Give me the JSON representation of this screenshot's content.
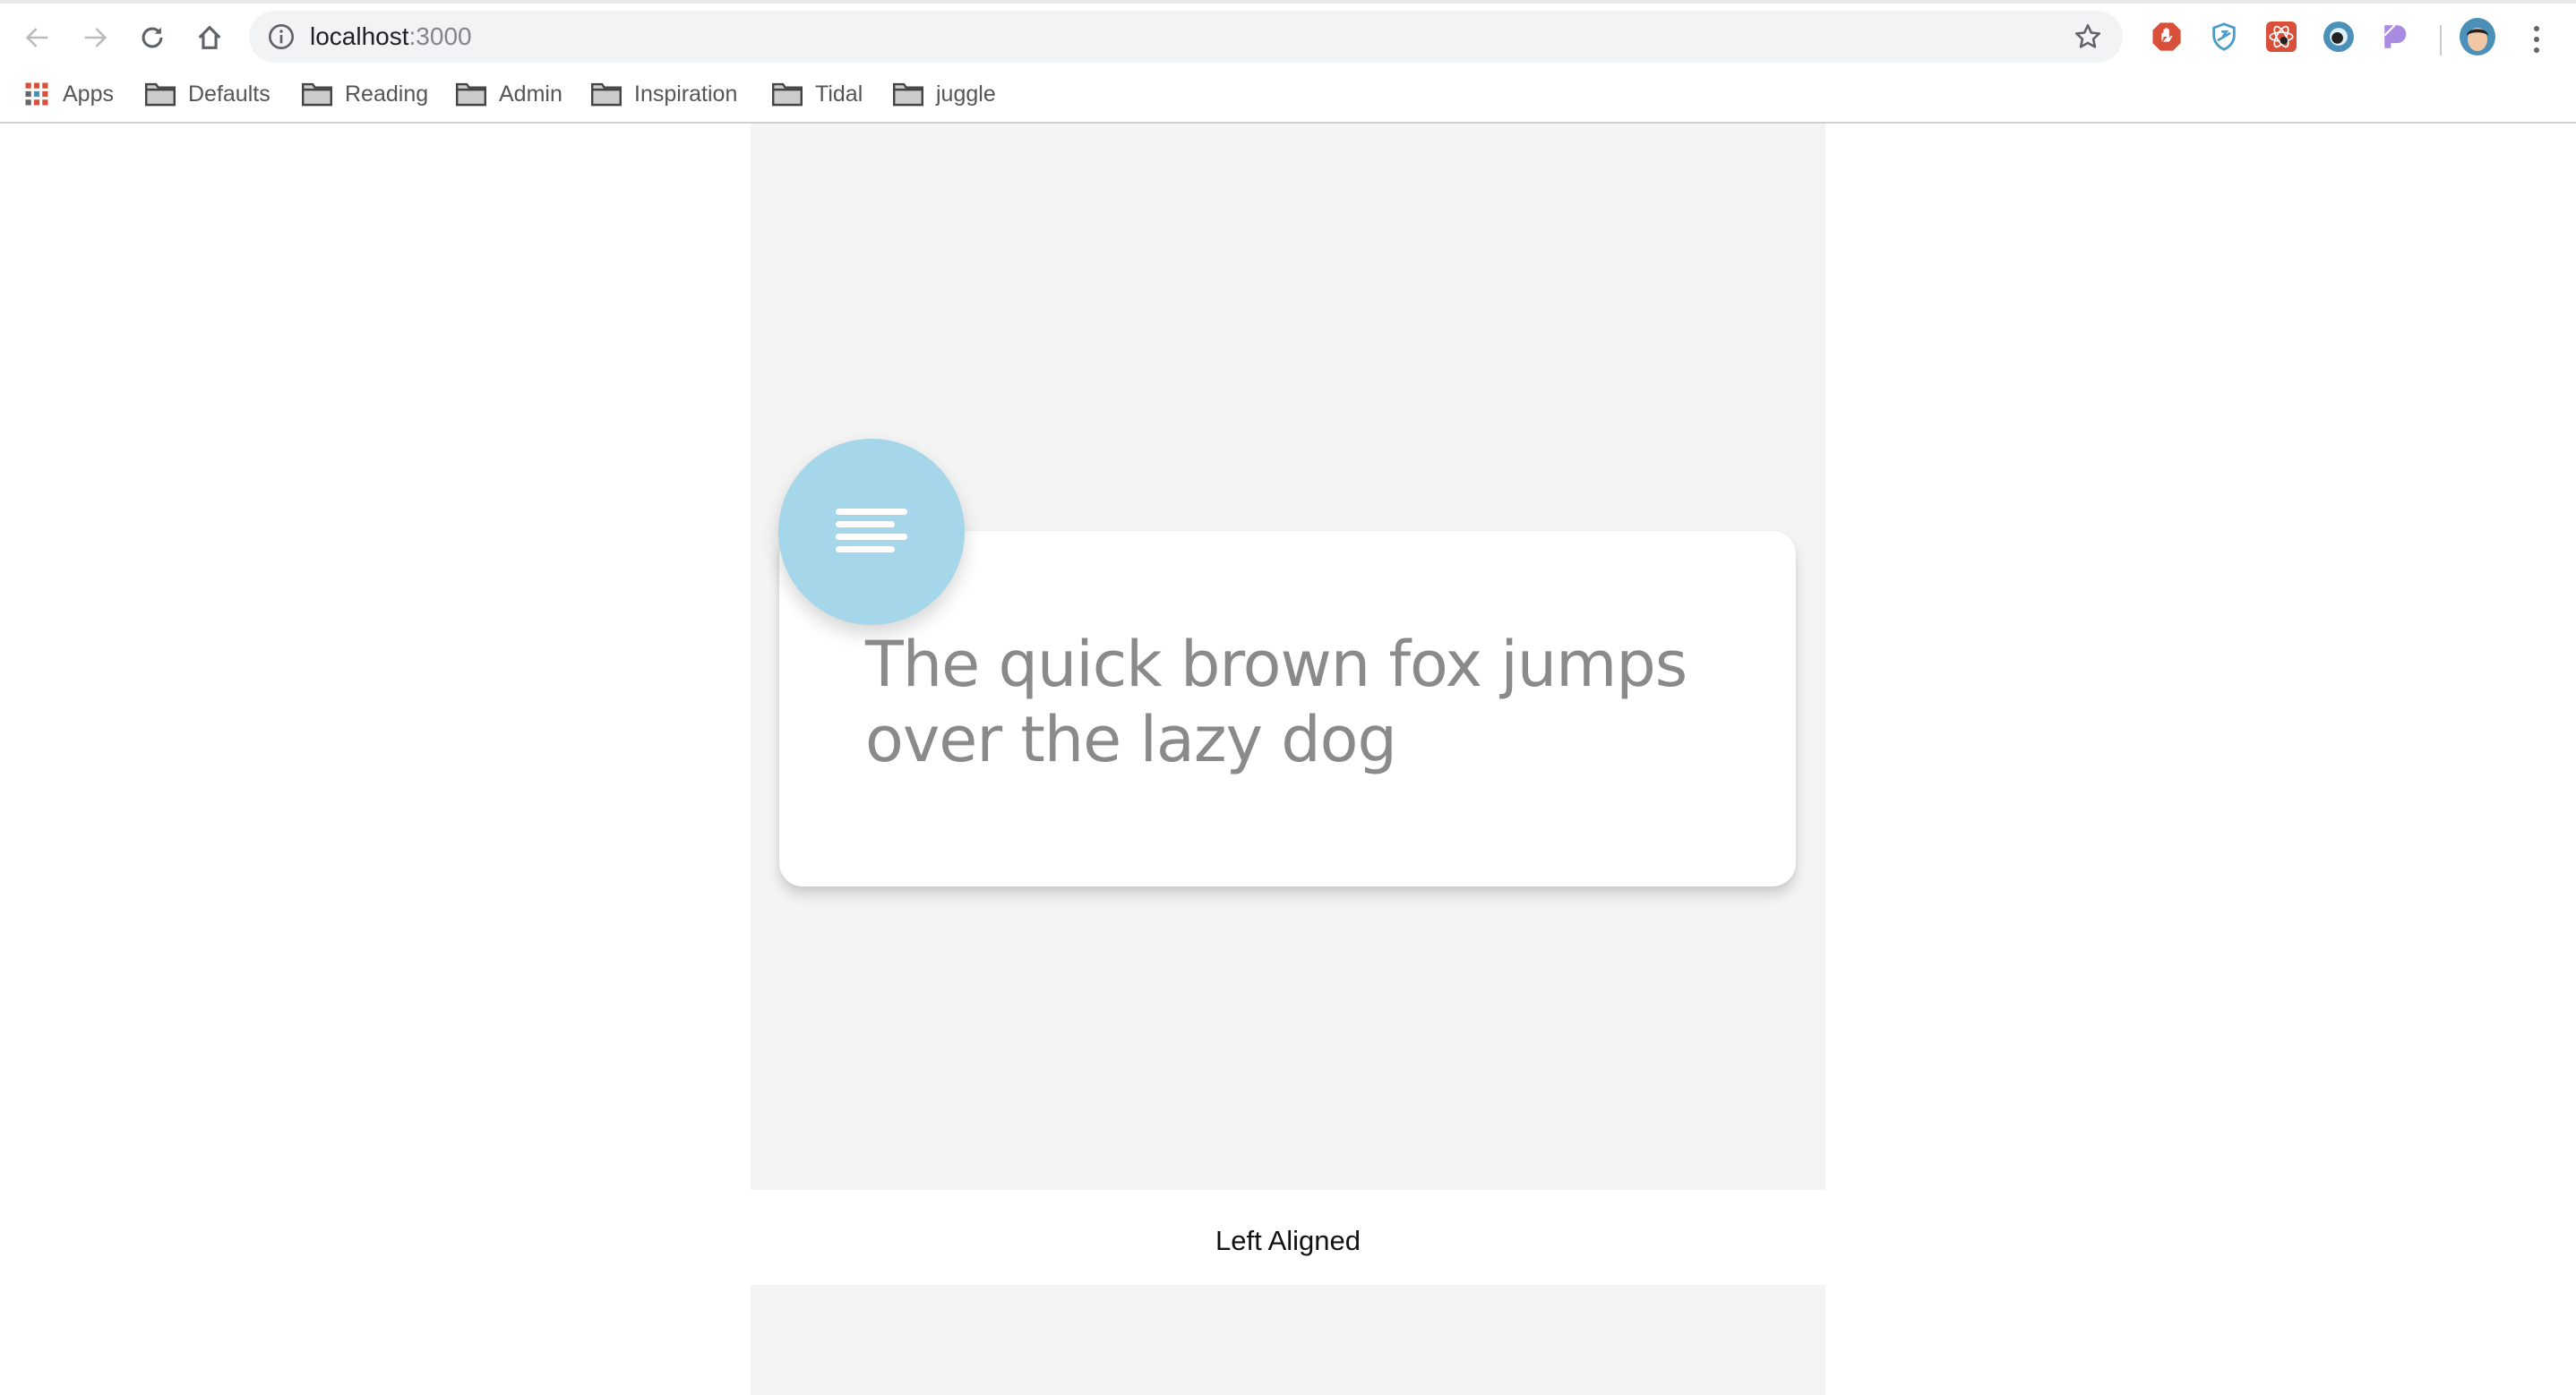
{
  "browser": {
    "url_host": "localhost",
    "url_port": ":3000",
    "nav": {
      "back": "back-icon",
      "forward": "forward-icon",
      "reload": "reload-icon",
      "home": "home-icon"
    },
    "extensions": [
      {
        "name": "adblock-extension-icon",
        "color": "#d9503a"
      },
      {
        "name": "shield-extension-icon",
        "color": "#4a9cc9"
      },
      {
        "name": "react-devtools-extension-icon",
        "color": "#d9503a"
      },
      {
        "name": "eye-extension-icon",
        "color": "#4a90b8"
      },
      {
        "name": "purple-extension-icon",
        "color": "#a98be3"
      }
    ]
  },
  "bookmarks": [
    {
      "label": "Apps",
      "icon": "apps-grid-icon"
    },
    {
      "label": "Defaults",
      "icon": "folder-icon"
    },
    {
      "label": "Reading",
      "icon": "folder-icon"
    },
    {
      "label": "Admin",
      "icon": "folder-icon"
    },
    {
      "label": "Inspiration",
      "icon": "folder-icon"
    },
    {
      "label": "Tidal",
      "icon": "folder-icon"
    },
    {
      "label": "juggle",
      "icon": "folder-icon"
    }
  ],
  "demo": {
    "card_text": "The quick brown fox jumps over the lazy dog",
    "card_icon": "align-left-icon",
    "caption": "Left Aligned",
    "accent_color": "#a5d6e9"
  }
}
